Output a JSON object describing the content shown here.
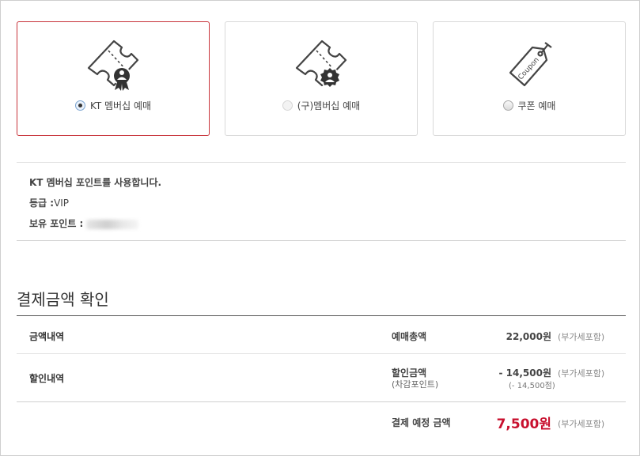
{
  "options": [
    {
      "label": "KT 멤버십 예매",
      "icon": "ticket-badge-icon",
      "selected": true
    },
    {
      "label": "(구)멤버십 예매",
      "icon": "ticket-seal-icon",
      "selected": false
    },
    {
      "label": "쿠폰 예매",
      "icon": "coupon-tag-icon",
      "selected": false,
      "tag_text": "Coupon"
    }
  ],
  "membership": {
    "notice": "KT 멤버십 포인트를 사용합니다.",
    "grade_label": "등급 :",
    "grade_value": "VIP",
    "points_label": "보유 포인트 :"
  },
  "payment": {
    "title": "결제금액 확인",
    "rows": {
      "amount": {
        "head": "금액내역",
        "label": "예매총액",
        "value": "22,000원",
        "vat": "(부가세포함)"
      },
      "discount": {
        "head": "할인내역",
        "label": "할인금액",
        "sublabel": "(차감포인트)",
        "value": "- 14,500원",
        "vat": "(부가세포함)",
        "subvalue": "(- 14,500점)"
      },
      "final": {
        "label": "결제 예정 금액",
        "value": "7,500원",
        "vat": "(부가세포함)"
      }
    }
  },
  "colors": {
    "accent": "#c8102e",
    "selected_border": "#c8333a"
  }
}
